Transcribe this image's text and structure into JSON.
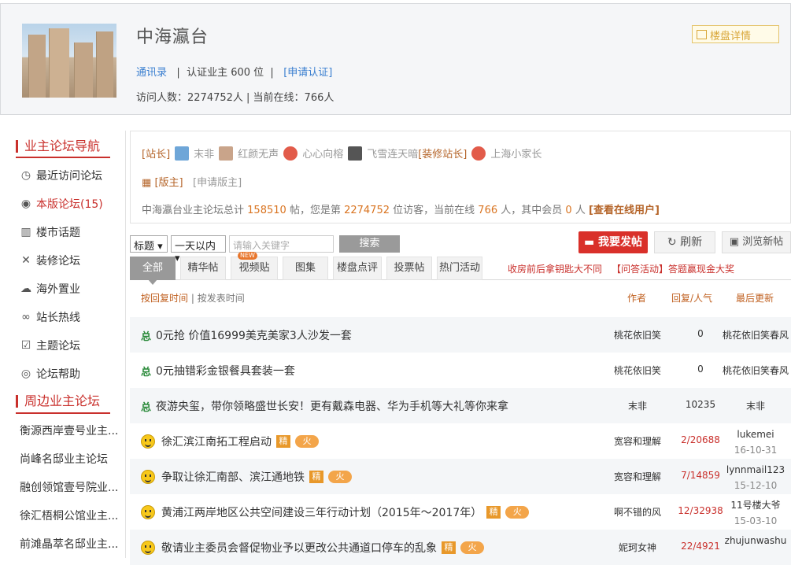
{
  "header": {
    "title": "中海瀛台",
    "contacts_link": "通讯录",
    "certified_text": "认证业主 600 位",
    "apply_cert_link": "[申请认证]",
    "visitors_text": "访问人数：2274752人 | 当前在线：766人",
    "detail_button": "楼盘详情"
  },
  "sidebar": {
    "nav_title": "业主论坛导航",
    "nav_items": [
      {
        "label": "最近访问论坛",
        "icon": "clock-icon"
      },
      {
        "label": "本版论坛(15)",
        "icon": "eye-icon"
      },
      {
        "label": "楼市话题",
        "icon": "building-icon"
      },
      {
        "label": "装修论坛",
        "icon": "tools-icon"
      },
      {
        "label": "海外置业",
        "icon": "chat-icon"
      },
      {
        "label": "站长热线",
        "icon": "link-icon"
      },
      {
        "label": "主题论坛",
        "icon": "edit-icon"
      },
      {
        "label": "论坛帮助",
        "icon": "help-icon"
      }
    ],
    "nearby_title": "周边业主论坛",
    "nearby_items": [
      "衡源西岸壹号业主...",
      "尚峰名邸业主论坛",
      "融创领馆壹号院业...",
      "徐汇梧桐公馆业主...",
      "前滩晶萃名邸业主..."
    ]
  },
  "moderators": {
    "station_label": "[站长]",
    "station_users": [
      "末非",
      "红颜无声",
      "心心向榕",
      "飞雪连天暗"
    ],
    "deco_label": "[装修站长]",
    "deco_user": "上海小家长",
    "mod_label": "[版主]",
    "apply_mod": "[申请版主]"
  },
  "stats": {
    "prefix": "中海瀛台业主论坛总计",
    "posts": "158510",
    "posts_unit": "帖，您是第",
    "visitor_no": "2274752",
    "visitor_unit": "位访客，当前在线",
    "online": "766",
    "online_unit": "人，其中会员",
    "members": "0",
    "members_unit": "人",
    "view_online": "[查看在线用户]"
  },
  "toolbar": {
    "field_select": "标题",
    "time_select": "一天以内",
    "search_placeholder": "请输入关键字",
    "search_button": "搜索",
    "post_button": "我要发帖",
    "refresh_button": "刷新",
    "browse_button": "浏览新帖"
  },
  "tabs": [
    "全部",
    "精华帖",
    "视频贴",
    "图集",
    "楼盘点评",
    "投票帖",
    "热门活动"
  ],
  "new_badge": "NEW",
  "promos": [
    "收房前后拿钥匙大不同",
    "【问答活动】答题赢现金大奖"
  ],
  "sort": {
    "by_reply": "按回复时间",
    "sep": "|",
    "by_post": "按发表时间"
  },
  "columns": {
    "author": "作者",
    "replies": "回复/人气",
    "last": "最后更新"
  },
  "labels": {
    "zong": "总",
    "jing": "精",
    "huo": "火"
  },
  "threads": [
    {
      "title": "0元抢 价值16999美克美家3人沙发一套",
      "author": "桃花依旧笑",
      "replies": "0",
      "last_user": "桃花依旧笑春风",
      "last_date": ""
    },
    {
      "title": "0元抽错彩金银餐具套装一套",
      "author": "桃花依旧笑",
      "replies": "0",
      "last_user": "桃花依旧笑春风",
      "last_date": ""
    },
    {
      "title": "夜游央玺，带你领略盛世长安！更有戴森电器、华为手机等大礼等你来拿",
      "author": "末非",
      "replies": "10235",
      "last_user": "末非",
      "last_date": ""
    },
    {
      "title": "徐汇滨江南拓工程启动",
      "author": "宽容和理解",
      "replies": "2/20688",
      "last_user": "lukemei",
      "last_date": "16-10-31"
    },
    {
      "title": "争取让徐汇南部、滨江通地铁",
      "author": "宽容和理解",
      "replies": "7/14859",
      "last_user": "lynnmail123",
      "last_date": "15-12-10"
    },
    {
      "title": "黄浦江两岸地区公共空间建设三年行动计划（2015年～2017年）",
      "author": "啊不错的风",
      "replies": "12/32938",
      "last_user": "11号楼大爷",
      "last_date": "15-03-10"
    },
    {
      "title": "敬请业主委员会督促物业予以更改公共通道口停车的乱象",
      "author": "妮珂女神",
      "replies": "22/4921",
      "last_user": "zhujunwashu",
      "last_date": ""
    }
  ]
}
